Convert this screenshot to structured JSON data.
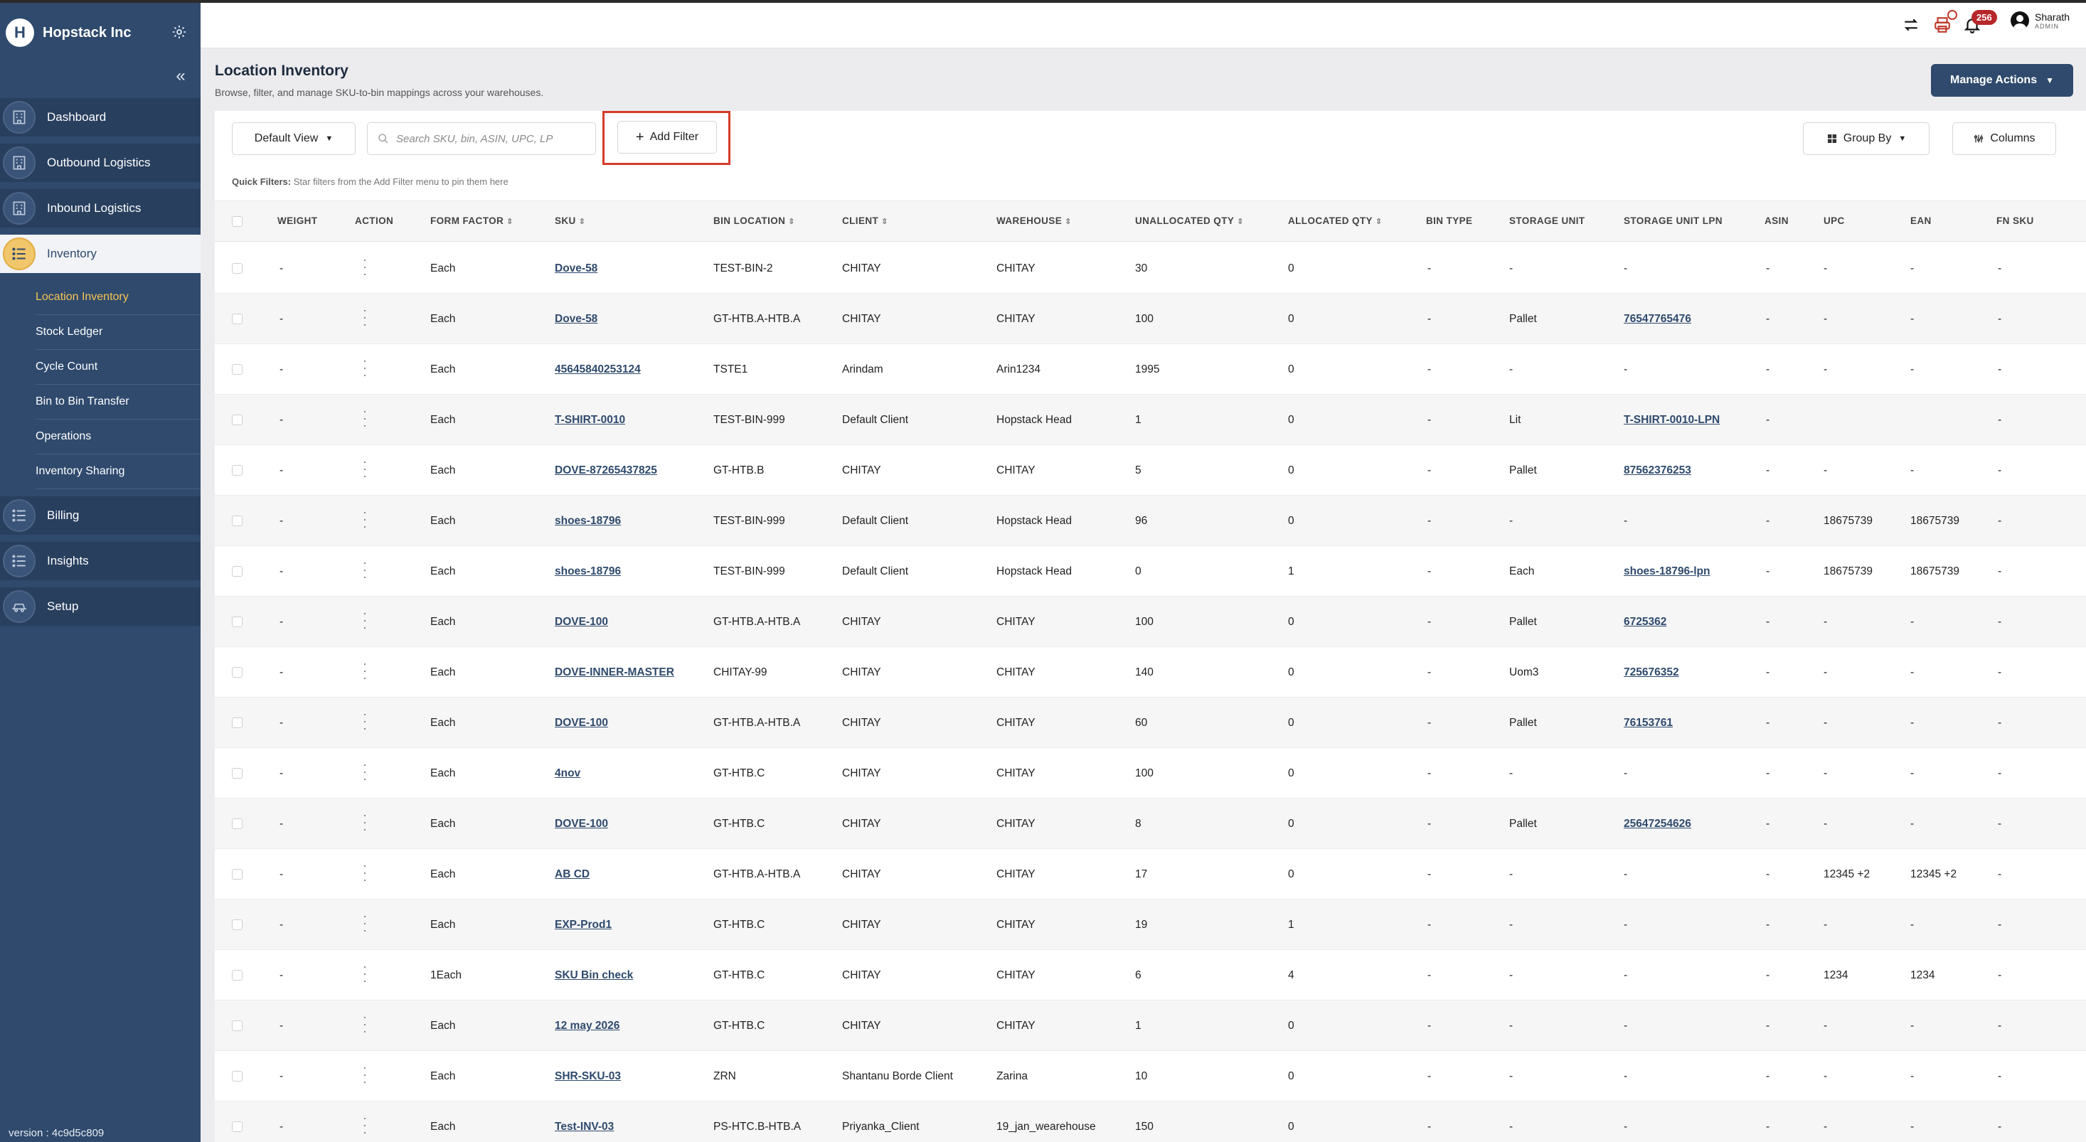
{
  "brand": {
    "name": "Hopstack Inc",
    "logo_letter": "H"
  },
  "sidebar": {
    "items": [
      {
        "label": "Dashboard"
      },
      {
        "label": "Outbound Logistics"
      },
      {
        "label": "Inbound Logistics"
      },
      {
        "label": "Inventory"
      }
    ],
    "inventory_sub": [
      {
        "label": "Location Inventory"
      },
      {
        "label": "Stock Ledger"
      },
      {
        "label": "Cycle Count"
      },
      {
        "label": "Bin to Bin Transfer"
      },
      {
        "label": "Operations"
      },
      {
        "label": "Inventory Sharing"
      }
    ],
    "bottom_items": [
      {
        "label": "Billing"
      },
      {
        "label": "Insights"
      },
      {
        "label": "Setup"
      }
    ],
    "version": "version : 4c9d5c809"
  },
  "topbar": {
    "notification_count": "256",
    "user_name": "Sharath",
    "user_role": "ADMIN"
  },
  "page": {
    "title": "Location Inventory",
    "subtitle": "Browse, filter, and manage SKU-to-bin mappings across your warehouses.",
    "manage_actions": "Manage Actions"
  },
  "toolbar": {
    "view": "Default View",
    "search_placeholder": "Search SKU, bin, ASIN, UPC, LP",
    "add_filter": "Add Filter",
    "group_by": "Group By",
    "columns": "Columns",
    "quick_filters_label": "Quick Filters:",
    "quick_filters_hint": "Star filters from the Add Filter menu to pin them here"
  },
  "table": {
    "headers": {
      "weight": "WEIGHT",
      "action": "ACTION",
      "form_factor": "FORM FACTOR",
      "sku": "SKU",
      "bin_location": "BIN LOCATION",
      "client": "CLIENT",
      "warehouse": "WAREHOUSE",
      "unallocated_qty": "UNALLOCATED QTY",
      "allocated_qty": "ALLOCATED QTY",
      "bin_type": "BIN TYPE",
      "storage_unit": "STORAGE UNIT",
      "storage_unit_lpn": "STORAGE UNIT LPN",
      "asin": "ASIN",
      "upc": "UPC",
      "ean": "EAN",
      "fn_sku": "FN SKU"
    },
    "rows": [
      {
        "weight": "-",
        "form_factor": "Each",
        "sku": "Dove-58",
        "bin": "TEST-BIN-2",
        "client": "CHITAY",
        "warehouse": "CHITAY",
        "unalloc": "30",
        "alloc": "0",
        "bin_type": "-",
        "storage_unit": "-",
        "lpn": "-",
        "lpn_link": false,
        "asin": "-",
        "upc": "-",
        "ean": "-",
        "fnsku": "-"
      },
      {
        "weight": "-",
        "form_factor": "Each",
        "sku": "Dove-58",
        "bin": "GT-HTB.A-HTB.A",
        "client": "CHITAY",
        "warehouse": "CHITAY",
        "unalloc": "100",
        "alloc": "0",
        "bin_type": "-",
        "storage_unit": "Pallet",
        "lpn": "76547765476",
        "lpn_link": true,
        "asin": "-",
        "upc": "-",
        "ean": "-",
        "fnsku": "-"
      },
      {
        "weight": "-",
        "form_factor": "Each",
        "sku": "45645840253124",
        "bin": "TSTE1",
        "client": "Arindam",
        "warehouse": "Arin1234",
        "unalloc": "1995",
        "alloc": "0",
        "bin_type": "-",
        "storage_unit": "-",
        "lpn": "-",
        "lpn_link": false,
        "asin": "-",
        "upc": "-",
        "ean": "-",
        "fnsku": "-"
      },
      {
        "weight": "-",
        "form_factor": "Each",
        "sku": "T-SHIRT-0010",
        "bin": "TEST-BIN-999",
        "client": "Default Client",
        "warehouse": "Hopstack Head",
        "unalloc": "1",
        "alloc": "0",
        "bin_type": "-",
        "storage_unit": "Lit",
        "lpn": "T-SHIRT-0010-LPN",
        "lpn_link": true,
        "asin": "-",
        "upc": "",
        "ean": "",
        "fnsku": "-"
      },
      {
        "weight": "-",
        "form_factor": "Each",
        "sku": "DOVE-87265437825",
        "bin": "GT-HTB.B",
        "client": "CHITAY",
        "warehouse": "CHITAY",
        "unalloc": "5",
        "alloc": "0",
        "bin_type": "-",
        "storage_unit": "Pallet",
        "lpn": "87562376253",
        "lpn_link": true,
        "asin": "-",
        "upc": "-",
        "ean": "-",
        "fnsku": "-"
      },
      {
        "weight": "-",
        "form_factor": "Each",
        "sku": "shoes-18796",
        "bin": "TEST-BIN-999",
        "client": "Default Client",
        "warehouse": "Hopstack Head",
        "unalloc": "96",
        "alloc": "0",
        "bin_type": "-",
        "storage_unit": "-",
        "lpn": "-",
        "lpn_link": false,
        "asin": "-",
        "upc": "18675739",
        "ean": "18675739",
        "fnsku": "-"
      },
      {
        "weight": "-",
        "form_factor": "Each",
        "sku": "shoes-18796",
        "bin": "TEST-BIN-999",
        "client": "Default Client",
        "warehouse": "Hopstack Head",
        "unalloc": "0",
        "alloc": "1",
        "bin_type": "-",
        "storage_unit": "Each",
        "lpn": "shoes-18796-lpn",
        "lpn_link": true,
        "asin": "-",
        "upc": "18675739",
        "ean": "18675739",
        "fnsku": "-"
      },
      {
        "weight": "-",
        "form_factor": "Each",
        "sku": "DOVE-100",
        "bin": "GT-HTB.A-HTB.A",
        "client": "CHITAY",
        "warehouse": "CHITAY",
        "unalloc": "100",
        "alloc": "0",
        "bin_type": "-",
        "storage_unit": "Pallet",
        "lpn": "6725362",
        "lpn_link": true,
        "asin": "-",
        "upc": "-",
        "ean": "-",
        "fnsku": "-"
      },
      {
        "weight": "-",
        "form_factor": "Each",
        "sku": "DOVE-INNER-MASTER",
        "bin": "CHITAY-99",
        "client": "CHITAY",
        "warehouse": "CHITAY",
        "unalloc": "140",
        "alloc": "0",
        "bin_type": "-",
        "storage_unit": "Uom3",
        "lpn": "725676352",
        "lpn_link": true,
        "asin": "-",
        "upc": "-",
        "ean": "-",
        "fnsku": "-"
      },
      {
        "weight": "-",
        "form_factor": "Each",
        "sku": "DOVE-100",
        "bin": "GT-HTB.A-HTB.A",
        "client": "CHITAY",
        "warehouse": "CHITAY",
        "unalloc": "60",
        "alloc": "0",
        "bin_type": "-",
        "storage_unit": "Pallet",
        "lpn": "76153761",
        "lpn_link": true,
        "asin": "-",
        "upc": "-",
        "ean": "-",
        "fnsku": "-"
      },
      {
        "weight": "-",
        "form_factor": "Each",
        "sku": "4nov",
        "bin": "GT-HTB.C",
        "client": "CHITAY",
        "warehouse": "CHITAY",
        "unalloc": "100",
        "alloc": "0",
        "bin_type": "-",
        "storage_unit": "-",
        "lpn": "-",
        "lpn_link": false,
        "asin": "-",
        "upc": "-",
        "ean": "-",
        "fnsku": "-"
      },
      {
        "weight": "-",
        "form_factor": "Each",
        "sku": "DOVE-100",
        "bin": "GT-HTB.C",
        "client": "CHITAY",
        "warehouse": "CHITAY",
        "unalloc": "8",
        "alloc": "0",
        "bin_type": "-",
        "storage_unit": "Pallet",
        "lpn": "25647254626",
        "lpn_link": true,
        "asin": "-",
        "upc": "-",
        "ean": "-",
        "fnsku": "-"
      },
      {
        "weight": "-",
        "form_factor": "Each",
        "sku": "AB CD",
        "bin": "GT-HTB.A-HTB.A",
        "client": "CHITAY",
        "warehouse": "CHITAY",
        "unalloc": "17",
        "alloc": "0",
        "bin_type": "-",
        "storage_unit": "-",
        "lpn": "-",
        "lpn_link": false,
        "asin": "-",
        "upc": "12345 +2",
        "ean": "12345 +2",
        "fnsku": "-"
      },
      {
        "weight": "-",
        "form_factor": "Each",
        "sku": "EXP-Prod1",
        "bin": "GT-HTB.C",
        "client": "CHITAY",
        "warehouse": "CHITAY",
        "unalloc": "19",
        "alloc": "1",
        "bin_type": "-",
        "storage_unit": "-",
        "lpn": "-",
        "lpn_link": false,
        "asin": "-",
        "upc": "-",
        "ean": "-",
        "fnsku": "-"
      },
      {
        "weight": "-",
        "form_factor": "1Each",
        "sku": "SKU Bin check",
        "bin": "GT-HTB.C",
        "client": "CHITAY",
        "warehouse": "CHITAY",
        "unalloc": "6",
        "alloc": "4",
        "bin_type": "-",
        "storage_unit": "-",
        "lpn": "-",
        "lpn_link": false,
        "asin": "-",
        "upc": "1234",
        "ean": "1234",
        "fnsku": "-"
      },
      {
        "weight": "-",
        "form_factor": "Each",
        "sku": "12 may 2026",
        "bin": "GT-HTB.C",
        "client": "CHITAY",
        "warehouse": "CHITAY",
        "unalloc": "1",
        "alloc": "0",
        "bin_type": "-",
        "storage_unit": "-",
        "lpn": "-",
        "lpn_link": false,
        "asin": "-",
        "upc": "-",
        "ean": "-",
        "fnsku": "-"
      },
      {
        "weight": "-",
        "form_factor": "Each",
        "sku": "SHR-SKU-03",
        "bin": "ZRN",
        "client": "Shantanu Borde Client",
        "warehouse": "Zarina",
        "unalloc": "10",
        "alloc": "0",
        "bin_type": "-",
        "storage_unit": "-",
        "lpn": "-",
        "lpn_link": false,
        "asin": "-",
        "upc": "-",
        "ean": "-",
        "fnsku": "-"
      },
      {
        "weight": "-",
        "form_factor": "Each",
        "sku": "Test-INV-03",
        "bin": "PS-HTC.B-HTB.A",
        "client": "Priyanka_Client",
        "warehouse": "19_jan_wearehouse",
        "unalloc": "150",
        "alloc": "0",
        "bin_type": "-",
        "storage_unit": "-",
        "lpn": "-",
        "lpn_link": false,
        "asin": "-",
        "upc": "-",
        "ean": "-",
        "fnsku": "-"
      }
    ]
  },
  "colors": {
    "sidebar": "#2f4a6d",
    "accent": "#f5c453",
    "highlight": "#d43b2b"
  }
}
